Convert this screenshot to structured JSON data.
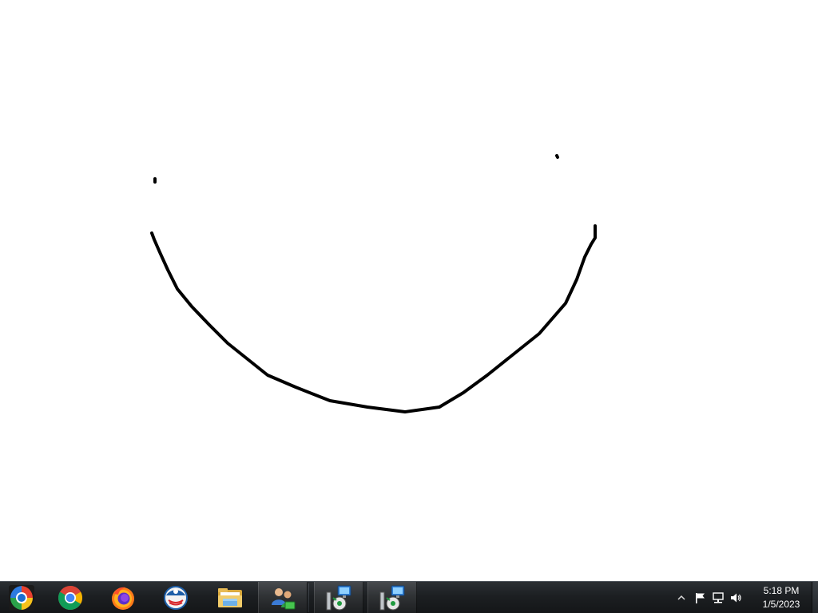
{
  "tray": {
    "time": "5:18 PM",
    "date": "1/5/2023"
  }
}
